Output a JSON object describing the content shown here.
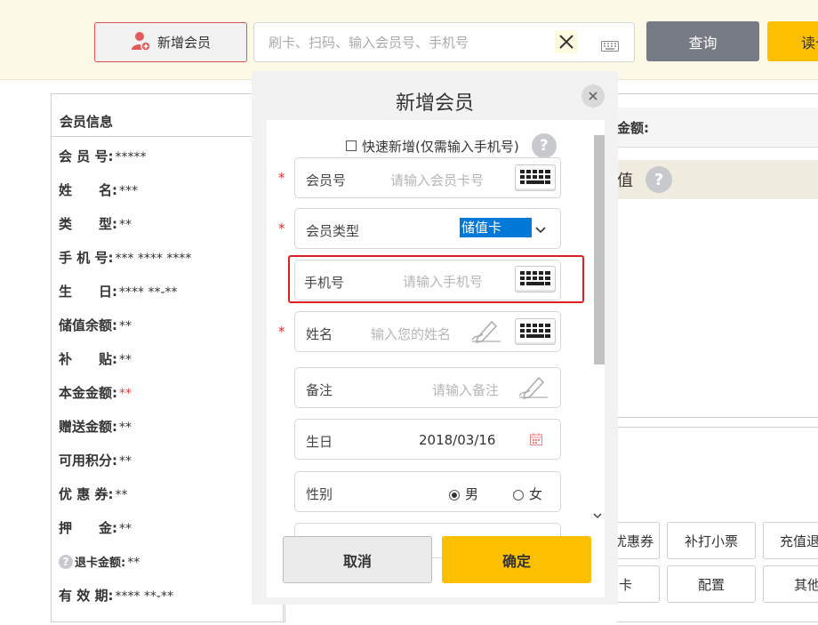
{
  "toolbar": {
    "add_member_label": "新增会员",
    "search_placeholder": "刷卡、扫码、输入会员号、手机号",
    "query_label": "查询",
    "read_label": "读卡"
  },
  "member_info": {
    "title": "会员信息",
    "rows": [
      {
        "label": "会 员 号:",
        "value": "*****"
      },
      {
        "label": "姓　　名:",
        "value": "***"
      },
      {
        "label": "类　　型:",
        "value": "**"
      },
      {
        "label": "手 机 号:",
        "value": "*** **** ****"
      },
      {
        "label": "生　　日:",
        "value": "**** **-**"
      },
      {
        "label": "储值余额:",
        "value": "**"
      },
      {
        "label": "补　　贴:",
        "value": "**"
      },
      {
        "label": "本金金额:",
        "value": "**"
      },
      {
        "label": "赠送金额:",
        "value": "**"
      },
      {
        "label": "可用积分:",
        "value": "**"
      },
      {
        "label": "优 惠 券:",
        "value": "**"
      },
      {
        "label": "押　　金:",
        "value": "**"
      },
      {
        "label": "退卡金额:",
        "value": "**"
      },
      {
        "label": "有 效 期:",
        "value": "**** **-**"
      }
    ]
  },
  "right_panel": {
    "amount_label": "金额:",
    "hint_text": "值",
    "buttons": [
      "优惠券",
      "补打小票",
      "充值退",
      "卡",
      "配置",
      "其他"
    ]
  },
  "modal": {
    "title": "新增会员",
    "quick_add_label": "快速新增(仅需输入手机号)",
    "fields": {
      "card_no": {
        "label": "会员号",
        "placeholder": "请输入会员卡号"
      },
      "type": {
        "label": "会员类型",
        "value": "储值卡"
      },
      "phone": {
        "label": "手机号",
        "placeholder": "请输入手机号"
      },
      "name": {
        "label": "姓名",
        "placeholder": "输入您的姓名"
      },
      "remark": {
        "label": "备注",
        "placeholder": "请输入备注"
      },
      "birthday": {
        "label": "生日",
        "value": "2018/03/16"
      },
      "gender": {
        "label": "性别",
        "male": "男",
        "female": "女",
        "selected": "male"
      }
    },
    "cancel_label": "取消",
    "ok_label": "确定"
  },
  "colors": {
    "accent": "#fcc000",
    "query_button": "#777b85",
    "highlight": "#e02020",
    "selected": "#0078d7"
  }
}
